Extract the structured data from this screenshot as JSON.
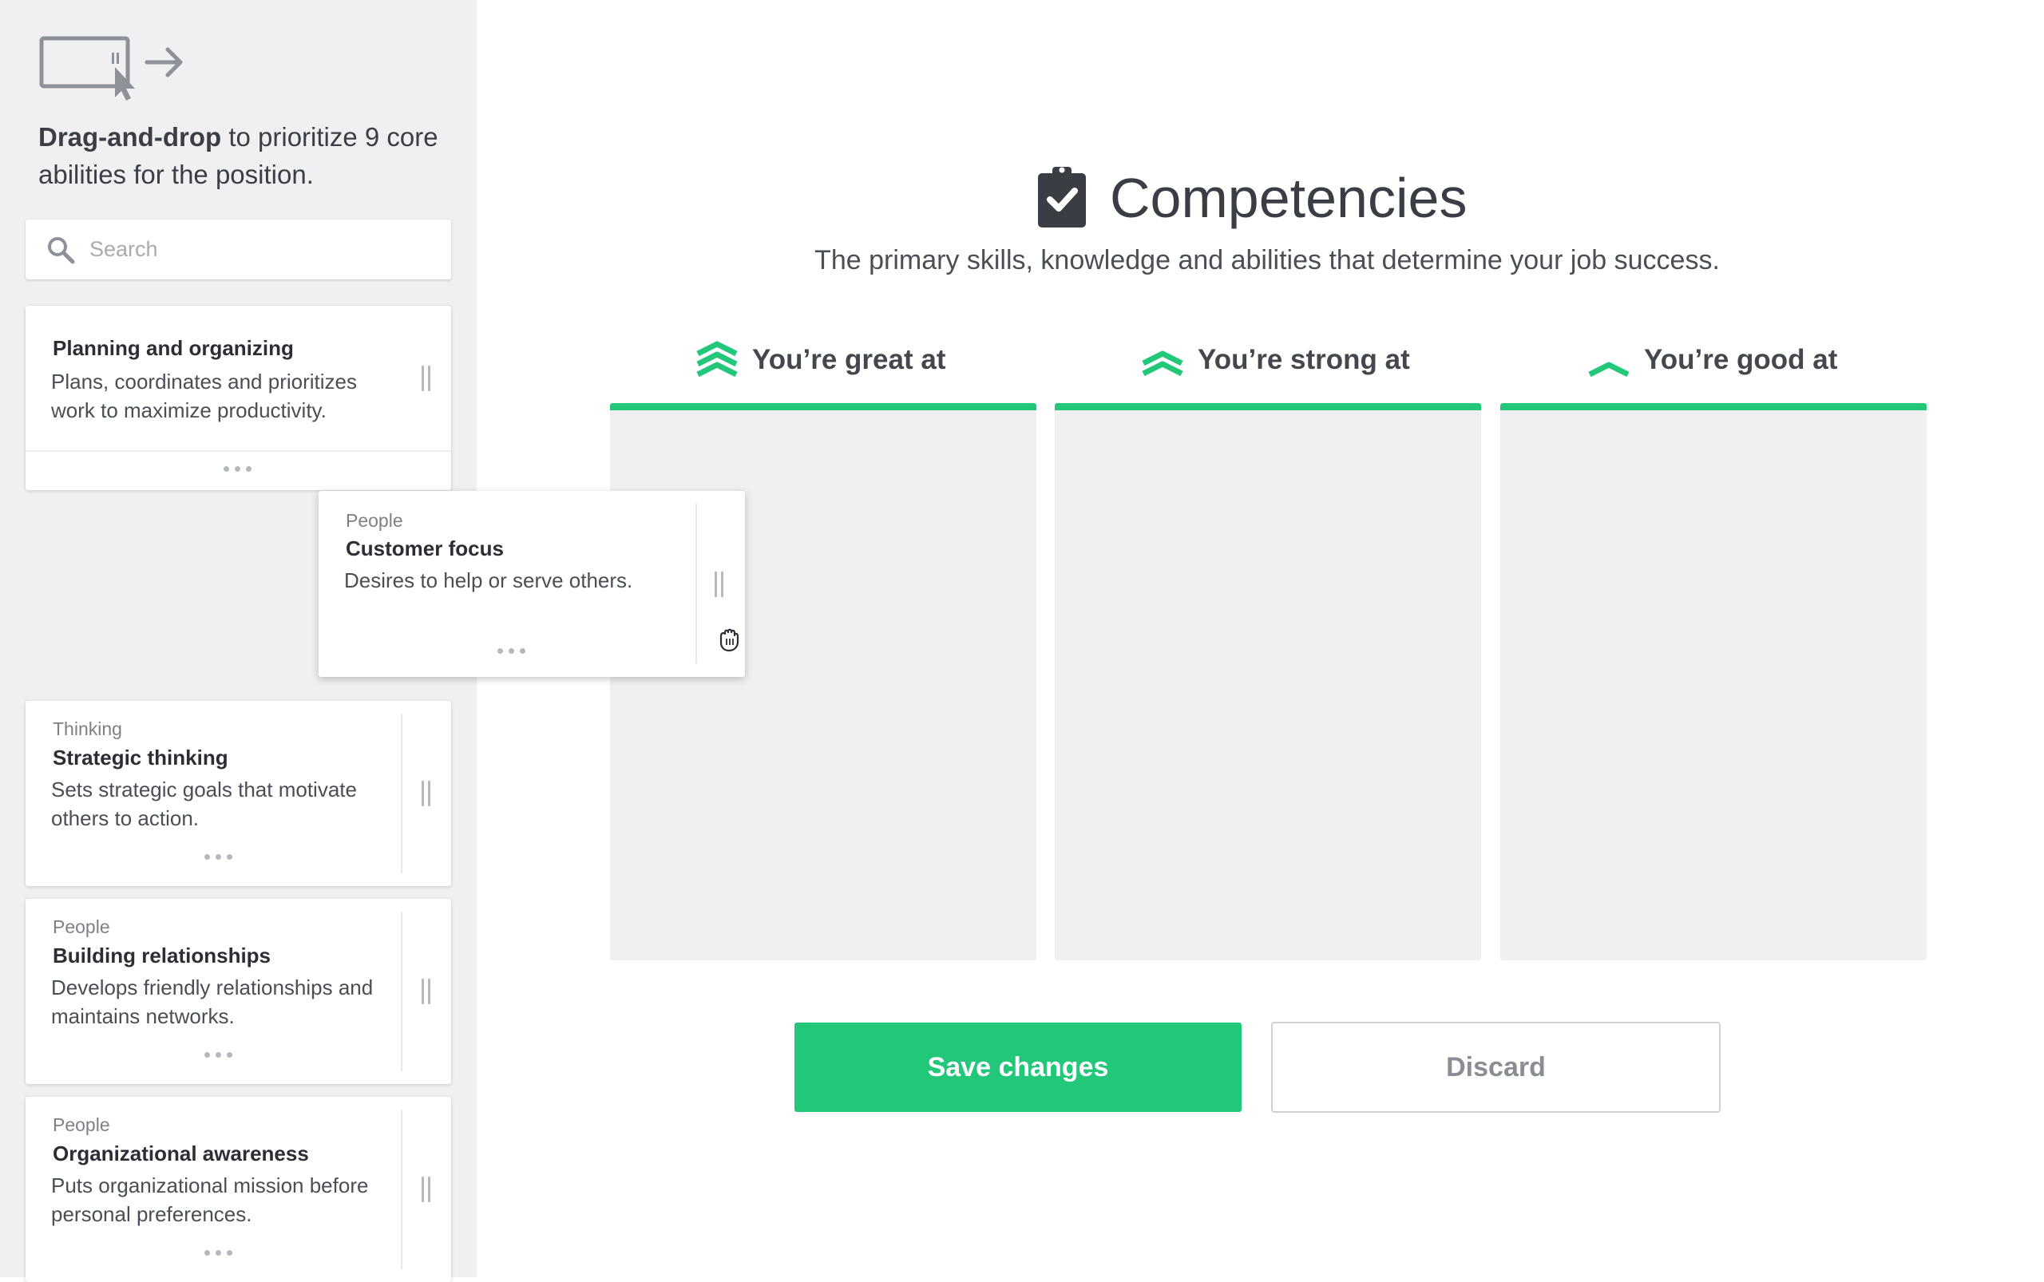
{
  "sidebar": {
    "instruction_bold": "Drag-and-drop",
    "instruction_rest": " to prioritize 9 core abilities for the position.",
    "search": {
      "placeholder": "Search"
    },
    "cards": [
      {
        "category": "",
        "title": "Planning and organizing",
        "description": "Plans, coordinates and prioritizes work to maximize productivity."
      },
      {
        "category": "Thinking",
        "title": "Strategic thinking",
        "description": "Sets strategic goals that motivate others to action."
      },
      {
        "category": "People",
        "title": "Building relationships",
        "description": "Develops friendly relationships and maintains networks."
      },
      {
        "category": "People",
        "title": "Organizational awareness",
        "description": "Puts organizational mission before personal preferences."
      }
    ]
  },
  "dragging_card": {
    "category": "People",
    "title": "Customer focus",
    "description": "Desires to help or serve others."
  },
  "header": {
    "title": "Competencies",
    "subtitle": "The primary skills, knowledge and abilities that determine your job success."
  },
  "columns": [
    {
      "label": "You’re great at",
      "icon": "triple-chevron-icon"
    },
    {
      "label": "You’re strong at",
      "icon": "double-chevron-icon"
    },
    {
      "label": "You’re good at",
      "icon": "single-chevron-icon"
    }
  ],
  "actions": {
    "save_label": "Save changes",
    "discard_label": "Discard"
  },
  "colors": {
    "accent": "#22c77a",
    "sidebar_bg": "#f0f0f2",
    "text": "#3b3f45"
  }
}
